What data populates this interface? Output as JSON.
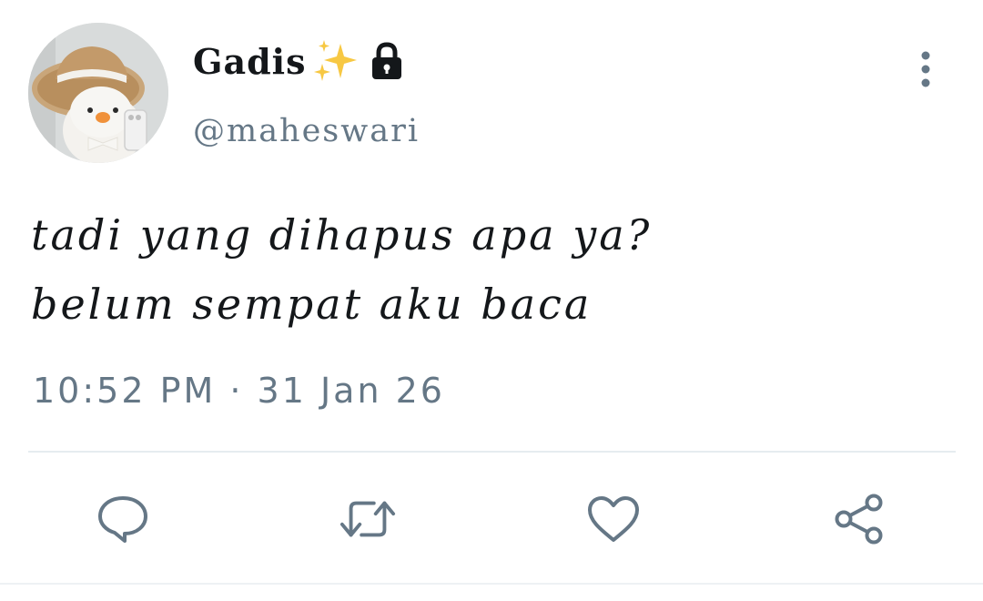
{
  "user": {
    "display_name": "Gadis",
    "display_emoji": "sparkles-icon",
    "protected_icon": "lock-icon",
    "handle": "@maheswari"
  },
  "tweet": {
    "text_lines": [
      "tadi yang dihapus apa ya?",
      "belum sempat aku baca"
    ],
    "timestamp": "10:52 PM · 31 Jan 26"
  },
  "actions": [
    {
      "name": "reply",
      "icon": "speech-bubble-icon"
    },
    {
      "name": "retweet",
      "icon": "retweet-arrows-icon"
    },
    {
      "name": "like",
      "icon": "heart-icon"
    },
    {
      "name": "share",
      "icon": "share-nodes-icon"
    }
  ],
  "menu": {
    "icon": "vertical-dots-icon"
  },
  "colors": {
    "text_primary": "#14171a",
    "text_secondary": "#657786",
    "icon_gray": "#657786",
    "divider": "#e6ecf0",
    "sparkle": "#f7c843"
  }
}
